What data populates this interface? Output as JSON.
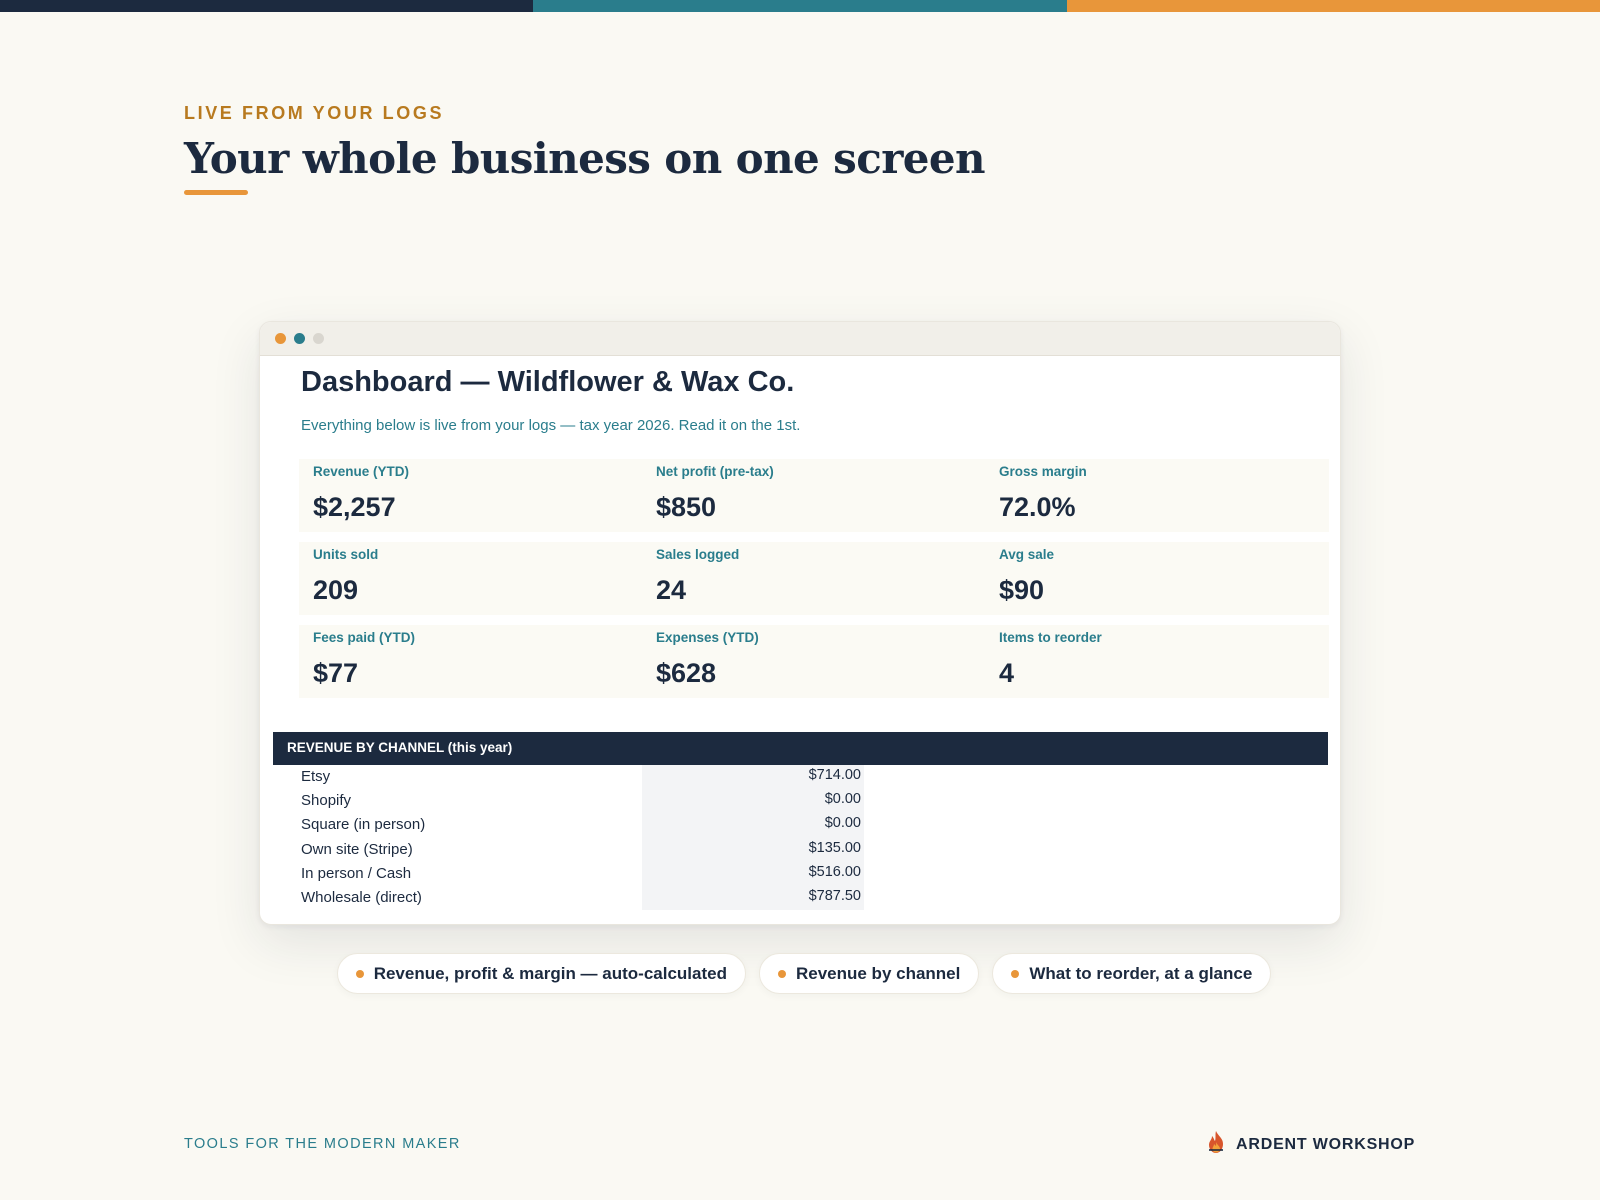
{
  "colors": {
    "navy": "#1c2a3f",
    "teal": "#2a7d8c",
    "orange": "#e8963a",
    "gold": "#b87a1f",
    "background": "#faf9f3",
    "top_bar": [
      "#1c2a3f",
      "#2a7d8c",
      "#e8963a"
    ]
  },
  "eyebrow": "LIVE FROM YOUR LOGS",
  "headline": "Your whole business on one screen",
  "window": {
    "dots": [
      "#e8963a",
      "#2a7d8c",
      "#d9d6cf"
    ],
    "title": "Dashboard — Wildflower & Wax Co.",
    "subtitle": "Everything below is live from your logs — tax year 2026. Read it on the 1st.",
    "kpis": [
      [
        {
          "label": "Revenue (YTD)",
          "value": "$2,257"
        },
        {
          "label": "Net profit (pre-tax)",
          "value": "$850"
        },
        {
          "label": "Gross margin",
          "value": "72.0%"
        }
      ],
      [
        {
          "label": "Units sold",
          "value": "209"
        },
        {
          "label": "Sales logged",
          "value": "24"
        },
        {
          "label": "Avg sale",
          "value": "$90"
        }
      ],
      [
        {
          "label": "Fees paid (YTD)",
          "value": "$77"
        },
        {
          "label": "Expenses (YTD)",
          "value": "$628"
        },
        {
          "label": "Items to reorder",
          "value": "4"
        }
      ]
    ],
    "channel_header": "REVENUE BY CHANNEL (this year)",
    "channels": [
      {
        "name": "Etsy",
        "value": "$714.00"
      },
      {
        "name": "Shopify",
        "value": "$0.00"
      },
      {
        "name": "Square (in person)",
        "value": "$0.00"
      },
      {
        "name": "Own site (Stripe)",
        "value": "$135.00"
      },
      {
        "name": "In person / Cash",
        "value": "$516.00"
      },
      {
        "name": "Wholesale (direct)",
        "value": "$787.50"
      }
    ]
  },
  "pills": [
    {
      "label": "Revenue, profit & margin — auto-calculated"
    },
    {
      "label": "Revenue by channel"
    },
    {
      "label": "What to reorder, at a glance"
    }
  ],
  "footer": {
    "tagline": "TOOLS FOR THE MODERN MAKER",
    "brand": "ARDENT WORKSHOP",
    "brand_icon": "flame-icon"
  }
}
